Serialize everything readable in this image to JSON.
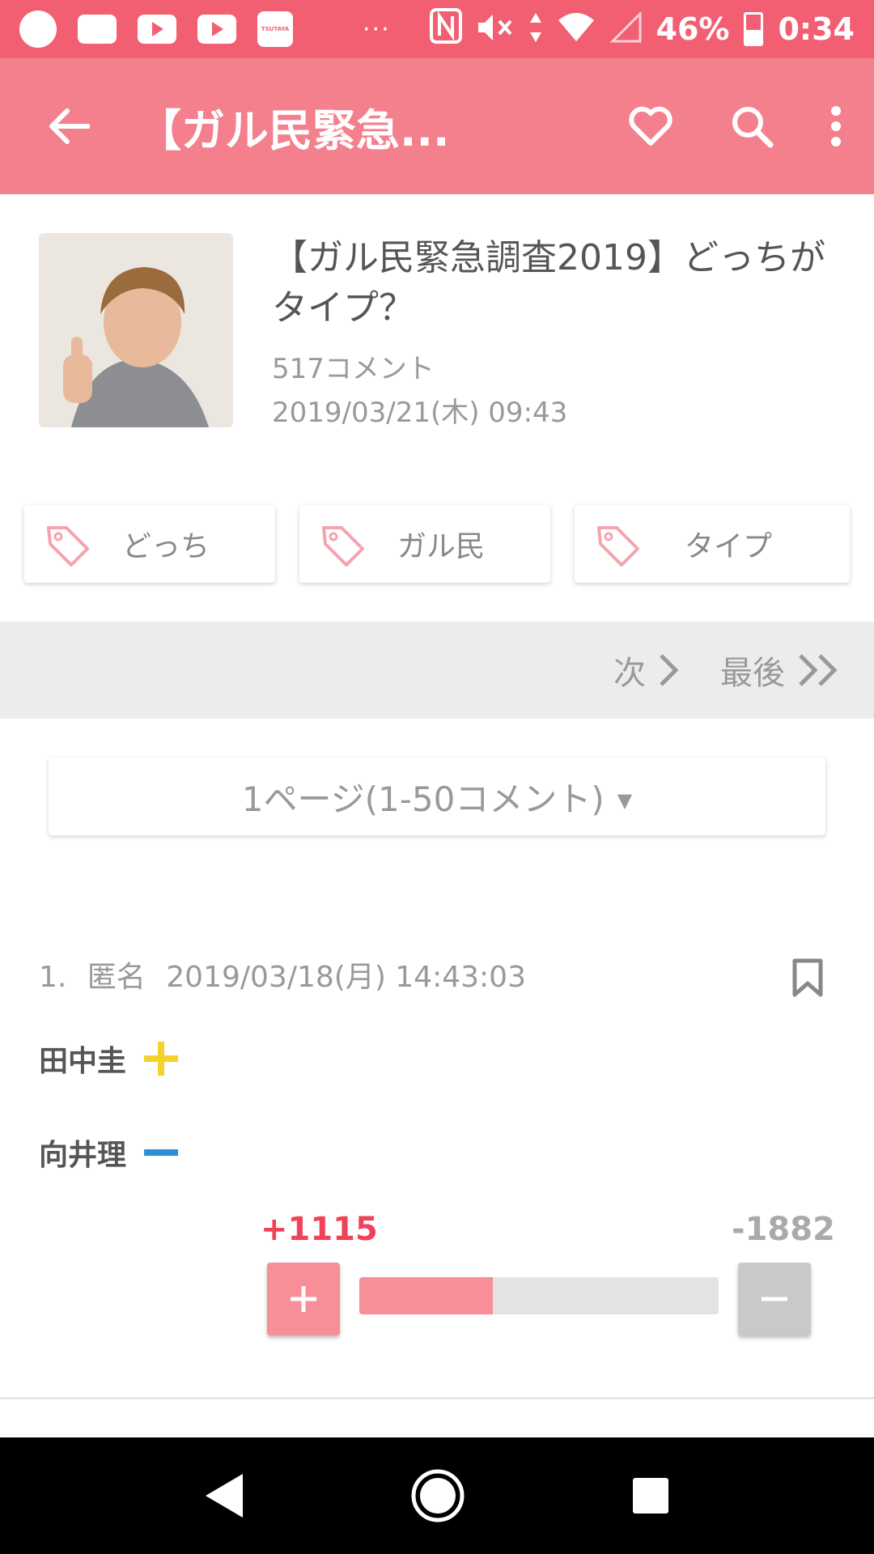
{
  "status_bar": {
    "tsutaya_label": "TSUTAYA",
    "dots": "···",
    "battery": "46%",
    "time": "0:34"
  },
  "app_bar": {
    "title": "【ガル民緊急..."
  },
  "topic": {
    "title": "【ガル民緊急調査2019】どっちがタイプ？",
    "comments": "517コメント",
    "date": "2019/03/21(木) 09:43"
  },
  "tags": [
    {
      "label": "どっち"
    },
    {
      "label": "ガル民"
    },
    {
      "label": "タイプ"
    }
  ],
  "pager": {
    "next_label": "次",
    "last_label": "最後"
  },
  "page_select": {
    "label": "1ページ(1-50コメント)",
    "caret": "▼"
  },
  "comment": {
    "number": "1.",
    "author": "匿名",
    "datetime": "2019/03/18(月) 14:43:03",
    "line1": "田中圭",
    "line2": "向井理",
    "plus_count": "+1115",
    "minus_count": "-1882",
    "plus_ratio": 0.372
  },
  "colors": {
    "status_bar": "#f25f72",
    "app_bar": "#f4808e",
    "plus": "#f0435a",
    "plus_button": "#f78e98",
    "minus_button": "#c9c9c9"
  }
}
